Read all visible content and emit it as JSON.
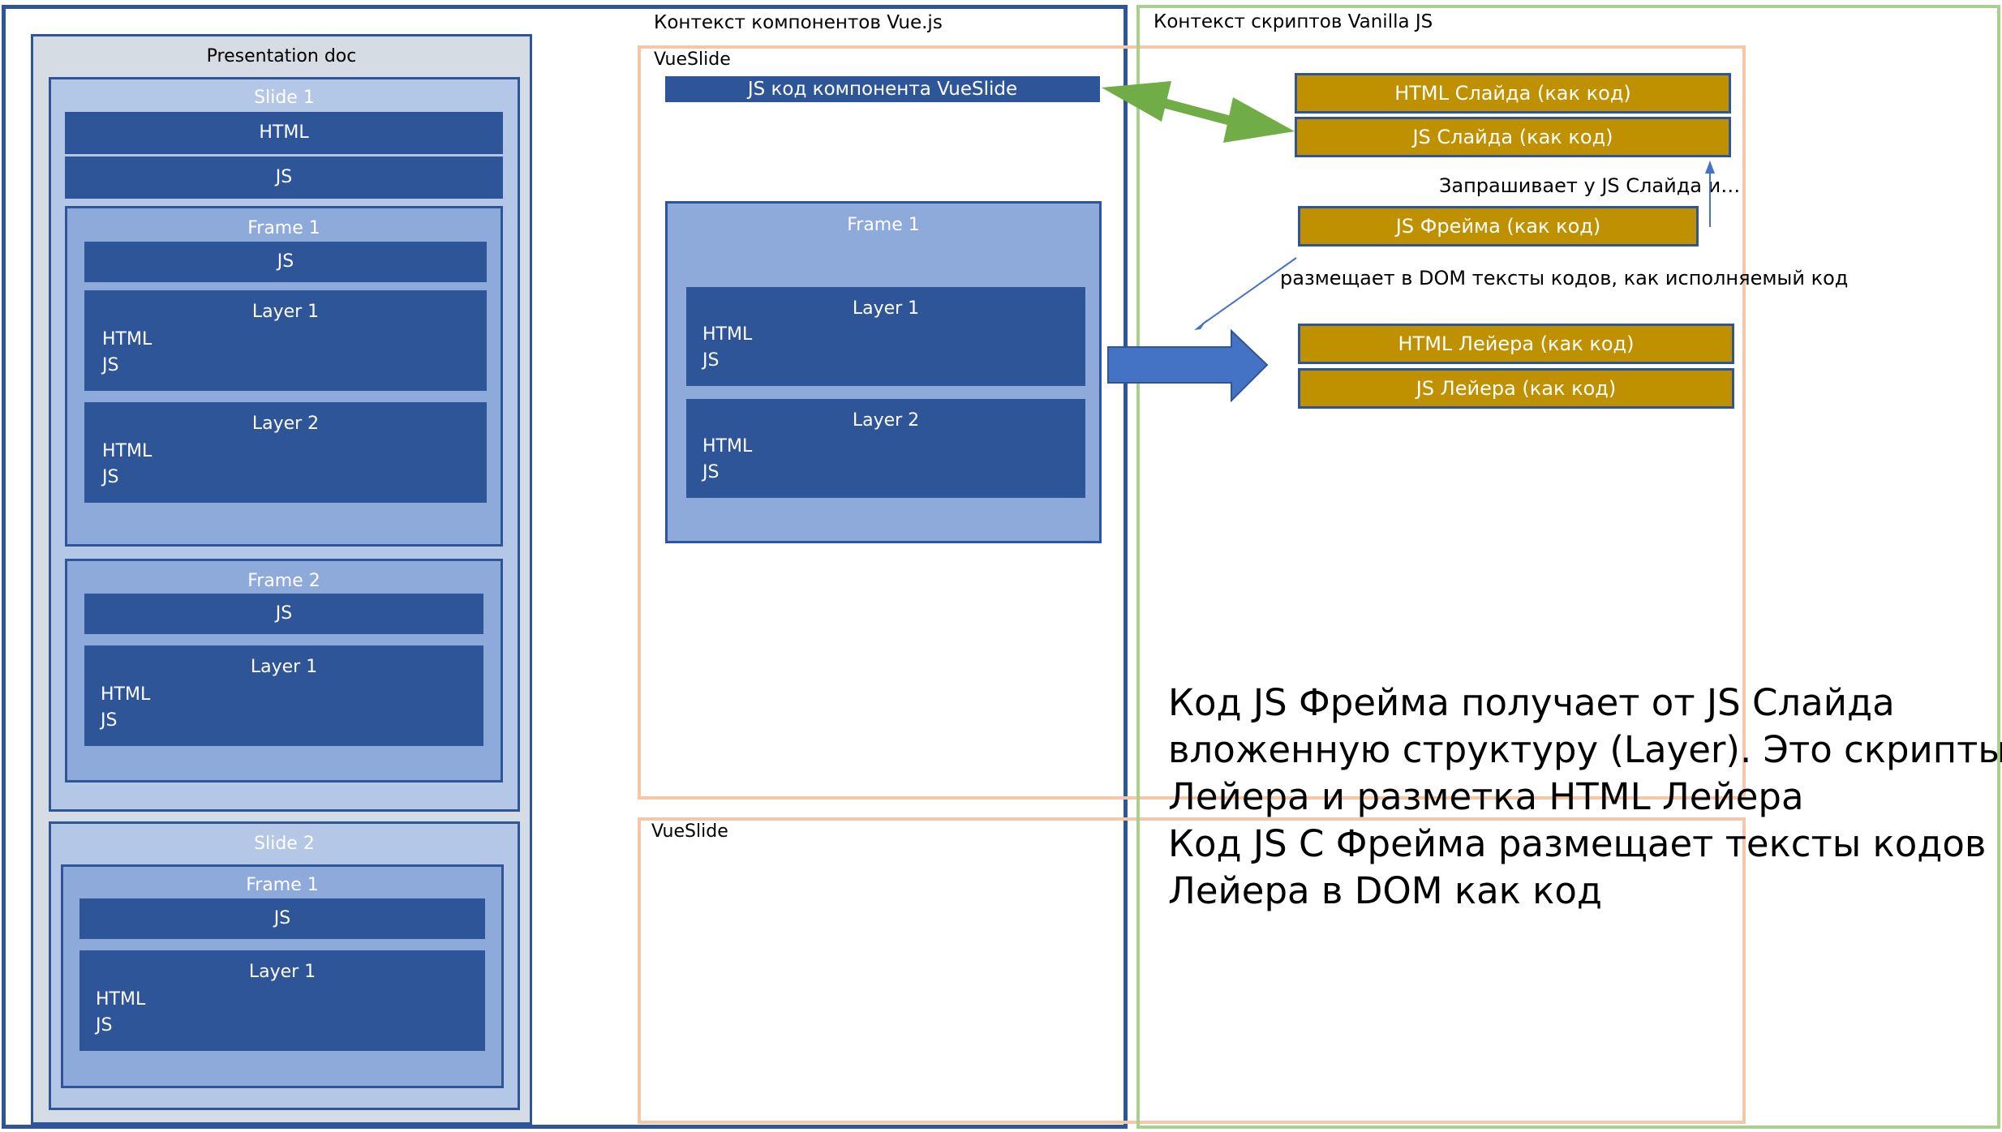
{
  "presentation": {
    "title": "Presentation doc",
    "slide1": {
      "title": "Slide 1",
      "html": "HTML",
      "js": "JS",
      "frame1": {
        "title": "Frame 1",
        "js": "JS",
        "layer1": {
          "title": "Layer 1",
          "html": "HTML",
          "js": "JS"
        },
        "layer2": {
          "title": "Layer 2",
          "html": "HTML",
          "js": "JS"
        }
      },
      "frame2": {
        "title": "Frame 2",
        "js": "JS",
        "layer1": {
          "title": "Layer 1",
          "html": "HTML",
          "js": "JS"
        }
      }
    },
    "slide2": {
      "title": "Slide 2",
      "frame1": {
        "title": "Frame 1",
        "js": "JS",
        "layer1": {
          "title": "Layer 1",
          "html": "HTML",
          "js": "JS"
        }
      }
    }
  },
  "vue_context": {
    "title": "Контекст компонентов Vue.js",
    "vueslide1": {
      "title": "VueSlide",
      "component_code": "JS код компонента VueSlide",
      "frame1": {
        "title": "Frame 1",
        "layer1": {
          "title": "Layer 1",
          "html": "HTML",
          "js": "JS"
        },
        "layer2": {
          "title": "Layer 2",
          "html": "HTML",
          "js": "JS"
        }
      }
    },
    "vueslide2": {
      "title": "VueSlide"
    }
  },
  "vanilla_context": {
    "title": "Контекст скриптов Vanilla JS",
    "slide_html": "HTML Слайда  (как код)",
    "slide_js": "JS Слайда (как код)",
    "request_note": "Запрашивает у JS Слайда и…",
    "frame_js": "JS Фрейма (как код)",
    "dom_note": "размещает в DOM тексты кодов, как исполняемый код",
    "layer_html": "HTML Лейера  (как код)",
    "layer_js": "JS Лейера (как код)"
  },
  "description": {
    "lines": [
      "Код JS Фрейма получает от JS Cлайда",
      "вложенную структуру (Layer). Это скрипты JS",
      "Лейера и разметка HTML Лейера",
      "Код JS C Фрейма размещает тексты кодов",
      "Лейера в DOM как код"
    ]
  },
  "colors": {
    "dark_blue": "#2e5597",
    "medium_blue": "#8eaadb",
    "light_blue": "#b4c7e7",
    "gray_blue": "#d6dce4",
    "gold": "#bf9000",
    "green": "#70ad47",
    "orange": "#f4c7a8",
    "arrow_blue": "#4472c4"
  }
}
